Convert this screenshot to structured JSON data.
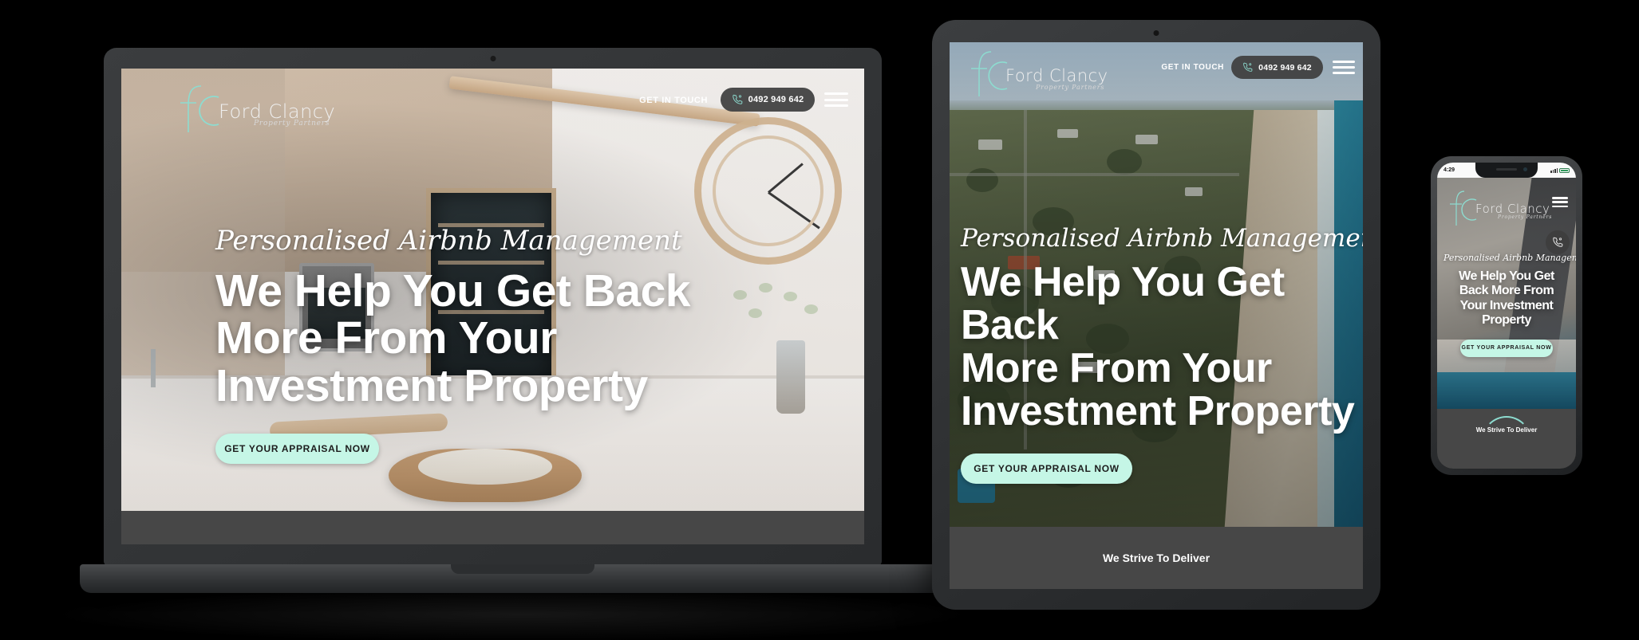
{
  "brand": {
    "name": "Ford Clancy",
    "tagline": "Property Partners",
    "monogram": "fc",
    "accent_teal": "#8ddcd0",
    "accent_mint": "#c5f6e6",
    "dark_pill": "#3e3e3e",
    "footer_band": "#474747"
  },
  "header": {
    "get_in_touch": "GET IN TOUCH",
    "phone": "0492 949 642",
    "phone_icon": "phone-icon",
    "menu_icon": "hamburger-menu-icon"
  },
  "hero": {
    "eyebrow": "Personalised Airbnb Management",
    "headline_lines_desktop": [
      "We Help You Get Back",
      "More From Your",
      "Investment Property"
    ],
    "headline_lines_mobile": [
      "We Help You Get",
      "Back More From",
      "Your Investment",
      "Property"
    ],
    "cta": "GET YOUR APPRAISAL NOW"
  },
  "footer": {
    "strive": "We Strive To Deliver"
  },
  "devices": {
    "laptop": {
      "label": "laptop-mockup"
    },
    "tablet": {
      "label": "tablet-mockup"
    },
    "phone": {
      "label": "phone-mockup",
      "status_time": "4:29"
    }
  }
}
